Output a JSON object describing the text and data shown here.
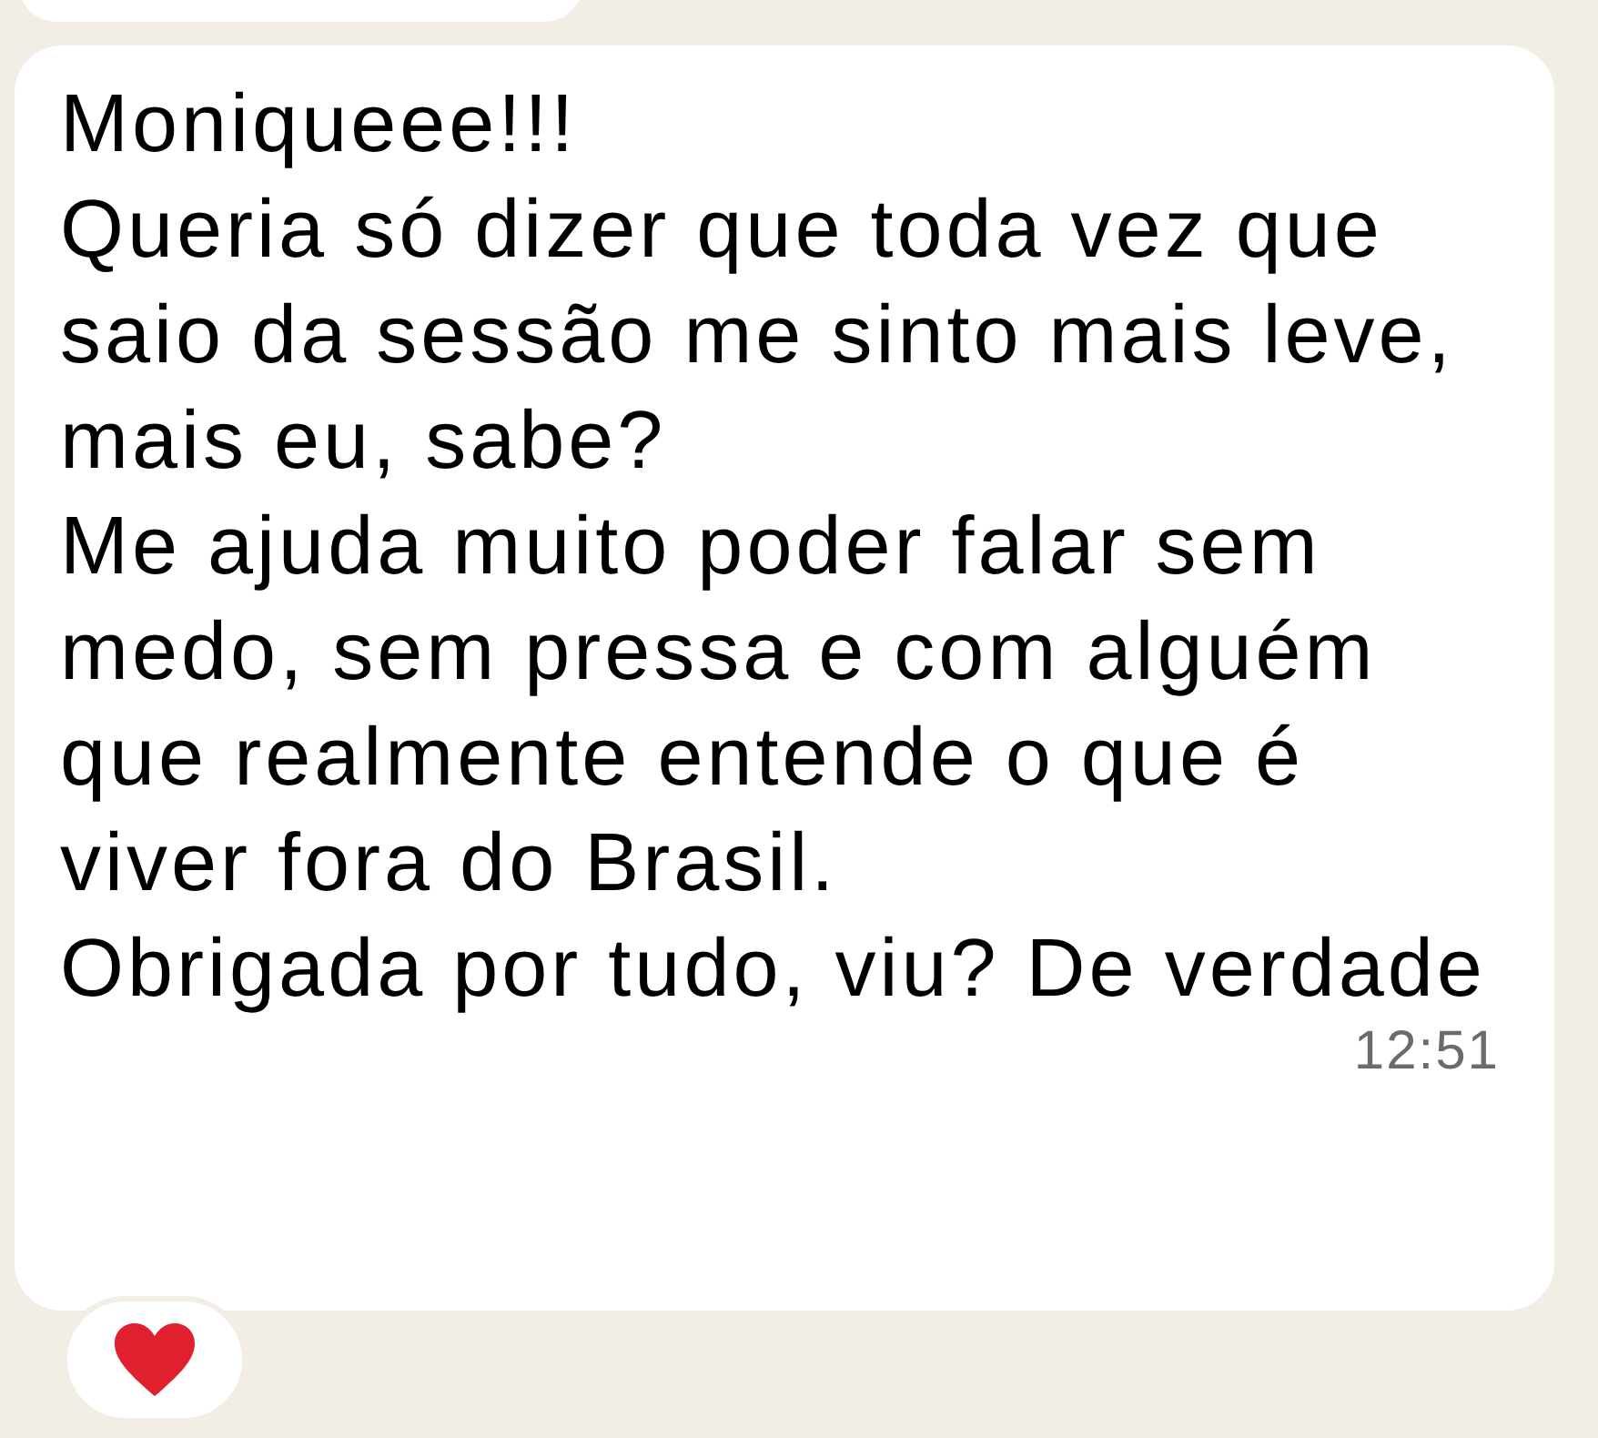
{
  "message": {
    "paragraphs": [
      "Moniqueee!!!",
      "Queria só dizer que toda vez que saio da sessão me sinto mais leve, mais eu, sabe?",
      "Me ajuda muito poder falar sem medo, sem pressa e com alguém que realmente entende o que é viver fora do Brasil.",
      "Obrigada por tudo, viu? De verdade"
    ],
    "time": "12:51",
    "reaction": {
      "kind": "heart"
    }
  }
}
